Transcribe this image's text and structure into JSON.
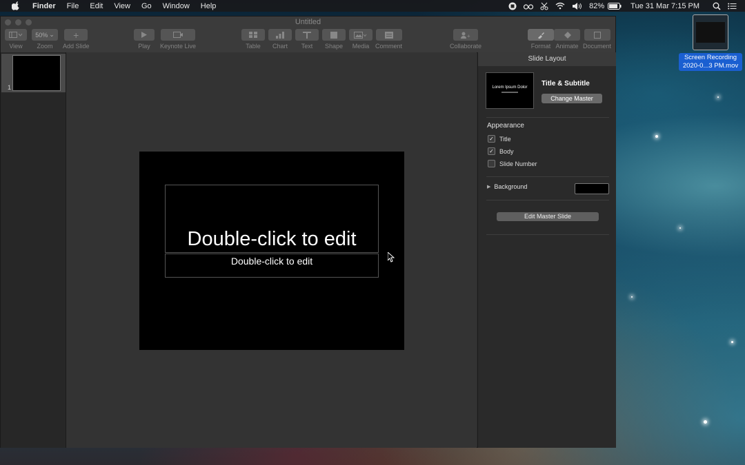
{
  "menubar": {
    "app_name": "Finder",
    "menus": [
      "File",
      "Edit",
      "View",
      "Go",
      "Window",
      "Help"
    ],
    "battery": "82%",
    "datetime": "Tue 31 Mar  7:15 PM"
  },
  "window": {
    "title": "Untitled"
  },
  "toolbar": {
    "view_label": "View",
    "zoom_value": "50%",
    "zoom_label": "Zoom",
    "add_slide_label": "Add Slide",
    "play_label": "Play",
    "keynote_live_label": "Keynote Live",
    "table_label": "Table",
    "chart_label": "Chart",
    "text_label": "Text",
    "shape_label": "Shape",
    "media_label": "Media",
    "comment_label": "Comment",
    "collaborate_label": "Collaborate",
    "format_label": "Format",
    "animate_label": "Animate",
    "document_label": "Document"
  },
  "navigator": {
    "slide_number": "1"
  },
  "slide": {
    "title_placeholder": "Double-click to edit",
    "subtitle_placeholder": "Double-click to edit"
  },
  "inspector": {
    "header": "Slide Layout",
    "master_preview_text": "Lorem Ipsum Dolor",
    "layout_name": "Title & Subtitle",
    "change_master_label": "Change Master",
    "appearance_title": "Appearance",
    "checkboxes": [
      {
        "label": "Title",
        "checked": true
      },
      {
        "label": "Body",
        "checked": true
      },
      {
        "label": "Slide Number",
        "checked": false
      }
    ],
    "background_label": "Background",
    "background_color": "#000000",
    "edit_master_label": "Edit Master Slide"
  },
  "desktop": {
    "icon_caption_line1": "Screen Recording",
    "icon_caption_line2": "2020-0...3 PM.mov"
  }
}
